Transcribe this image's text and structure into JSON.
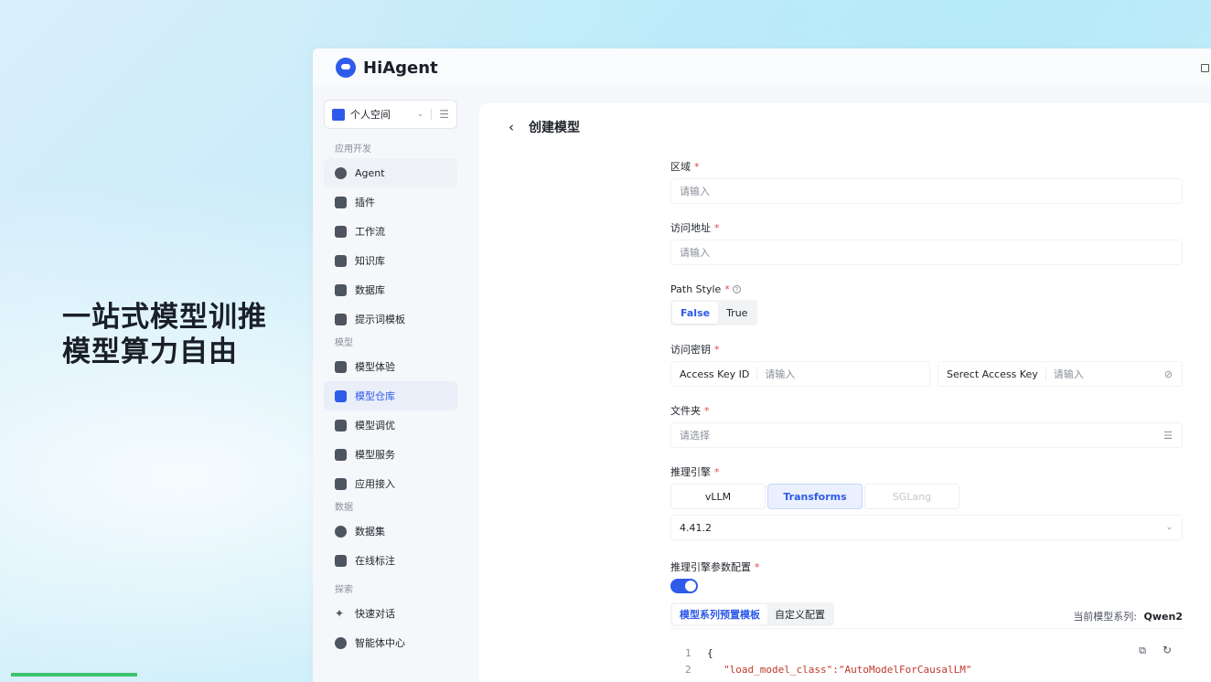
{
  "promo": {
    "line1": "一站式模型训推",
    "line2": "模型算力自由"
  },
  "app": {
    "name": "HiAgent"
  },
  "sidebar": {
    "space": {
      "label": "个人空间"
    },
    "sections": [
      {
        "title": "应用开发",
        "items": [
          {
            "label": "Agent",
            "icon": "robot-icon"
          },
          {
            "label": "插件",
            "icon": "puzzle-icon"
          },
          {
            "label": "工作流",
            "icon": "workflow-icon"
          },
          {
            "label": "知识库",
            "icon": "book-icon"
          },
          {
            "label": "数据库",
            "icon": "database-icon"
          },
          {
            "label": "提示词模板",
            "icon": "prompt-icon"
          }
        ]
      },
      {
        "title": "模型",
        "items": [
          {
            "label": "模型体验",
            "icon": "experience-icon"
          },
          {
            "label": "模型仓库",
            "icon": "cube-icon"
          },
          {
            "label": "模型调优",
            "icon": "flask-icon"
          },
          {
            "label": "模型服务",
            "icon": "service-icon"
          },
          {
            "label": "应用接入",
            "icon": "apps-icon"
          }
        ]
      },
      {
        "title": "数据",
        "items": [
          {
            "label": "数据集",
            "icon": "dataset-icon"
          },
          {
            "label": "在线标注",
            "icon": "annotate-icon"
          }
        ]
      },
      {
        "title": "探索",
        "items": [
          {
            "label": "快速对话",
            "icon": "sparkle-icon"
          },
          {
            "label": "智能体中心",
            "icon": "agent-center-icon"
          }
        ]
      }
    ],
    "active": "模型仓库"
  },
  "page": {
    "back": "‹",
    "title": "创建模型",
    "region": {
      "label": "区域",
      "placeholder": "请输入"
    },
    "endpoint": {
      "label": "访问地址",
      "placeholder": "请输入"
    },
    "path_style": {
      "label": "Path Style",
      "options": [
        "False",
        "True"
      ],
      "selected": "False"
    },
    "access_key": {
      "label": "访问密钥",
      "ak_label": "Access Key ID",
      "ak_placeholder": "请输入",
      "sk_label": "Serect Access Key",
      "sk_placeholder": "请输入"
    },
    "folder": {
      "label": "文件夹",
      "placeholder": "请选择"
    },
    "engine": {
      "label": "推理引擎",
      "options": [
        "vLLM",
        "Transforms",
        "SGLang"
      ],
      "selected": "Transforms",
      "version": "4.41.2"
    },
    "engine_params": {
      "label": "推理引擎参数配置",
      "enabled": true
    },
    "config_tabs": [
      "模型系列预置模板",
      "自定义配置"
    ],
    "series_label": "当前模型系列:",
    "series_value": "Qwen2",
    "code": {
      "line1_no": "1",
      "line1": "{",
      "line2_no": "2",
      "line2": "\"load_model_class\":\"AutoModelForCausalLM\""
    }
  },
  "colors": {
    "accent": "#2f5bea",
    "required": "#e5484d"
  }
}
